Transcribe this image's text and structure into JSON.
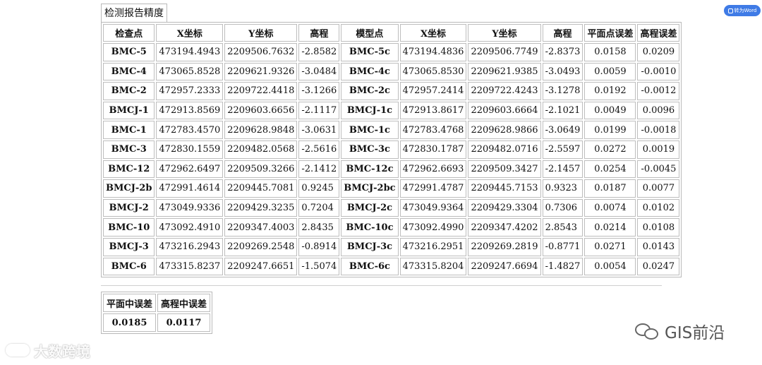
{
  "report_title": "检测报告精度",
  "word_button_label": "转为Word",
  "headers": [
    "检查点",
    "X坐标",
    "Y坐标",
    "高程",
    "模型点",
    "X坐标",
    "Y坐标",
    "高程",
    "平面点误差",
    "高程误差"
  ],
  "rows": [
    [
      "BMC-5",
      "473194.4943",
      "2209506.7632",
      "-2.8582",
      "BMC-5c",
      "473194.4836",
      "2209506.7749",
      "-2.8373",
      "0.0158",
      "0.0209"
    ],
    [
      "BMC-4",
      "473065.8528",
      "2209621.9326",
      "-3.0484",
      "BMC-4c",
      "473065.8530",
      "2209621.9385",
      "-3.0493",
      "0.0059",
      "-0.0010"
    ],
    [
      "BMC-2",
      "472957.2333",
      "2209722.4418",
      "-3.1266",
      "BMC-2c",
      "472957.2414",
      "2209722.4243",
      "-3.1278",
      "0.0192",
      "-0.0012"
    ],
    [
      "BMCJ-1",
      "472913.8569",
      "2209603.6656",
      "-2.1117",
      "BMCJ-1c",
      "472913.8617",
      "2209603.6664",
      "-2.1021",
      "0.0049",
      "0.0096"
    ],
    [
      "BMC-1",
      "472783.4570",
      "2209628.9848",
      "-3.0631",
      "BMC-1c",
      "472783.4768",
      "2209628.9866",
      "-3.0649",
      "0.0199",
      "-0.0018"
    ],
    [
      "BMC-3",
      "472830.1559",
      "2209482.0568",
      "-2.5616",
      "BMC-3c",
      "472830.1787",
      "2209482.0716",
      "-2.5597",
      "0.0272",
      "0.0019"
    ],
    [
      "BMC-12",
      "472962.6497",
      "2209509.3266",
      "-2.1412",
      "BMC-12c",
      "472962.6693",
      "2209509.3427",
      "-2.1457",
      "0.0254",
      "-0.0045"
    ],
    [
      "BMCJ-2b",
      "472991.4614",
      "2209445.7081",
      "0.9245",
      "BMCJ-2bc",
      "472991.4787",
      "2209445.7153",
      "0.9323",
      "0.0187",
      "0.0077"
    ],
    [
      "BMCJ-2",
      "473049.9336",
      "2209429.3235",
      "0.7204",
      "BMCJ-2c",
      "473049.9364",
      "2209429.3304",
      "0.7306",
      "0.0074",
      "0.0102"
    ],
    [
      "BMC-10",
      "473092.4910",
      "2209347.4003",
      "2.8435",
      "BMC-10c",
      "473092.4990",
      "2209347.4202",
      "2.8543",
      "0.0214",
      "0.0108"
    ],
    [
      "BMCJ-3",
      "473216.2943",
      "2209269.2548",
      "-0.8914",
      "BMCJ-3c",
      "473216.2951",
      "2209269.2819",
      "-0.8771",
      "0.0271",
      "0.0143"
    ],
    [
      "BMC-6",
      "473315.8237",
      "2209247.6651",
      "-1.5074",
      "BMC-6c",
      "473315.8204",
      "2209247.6694",
      "-1.4827",
      "0.0054",
      "0.0247"
    ]
  ],
  "summary": {
    "headers": [
      "平面中误差",
      "高程中误差"
    ],
    "values": [
      "0.0185",
      "0.0117"
    ]
  },
  "watermark_left": "大数跨境",
  "watermark_right": "GIS前沿"
}
